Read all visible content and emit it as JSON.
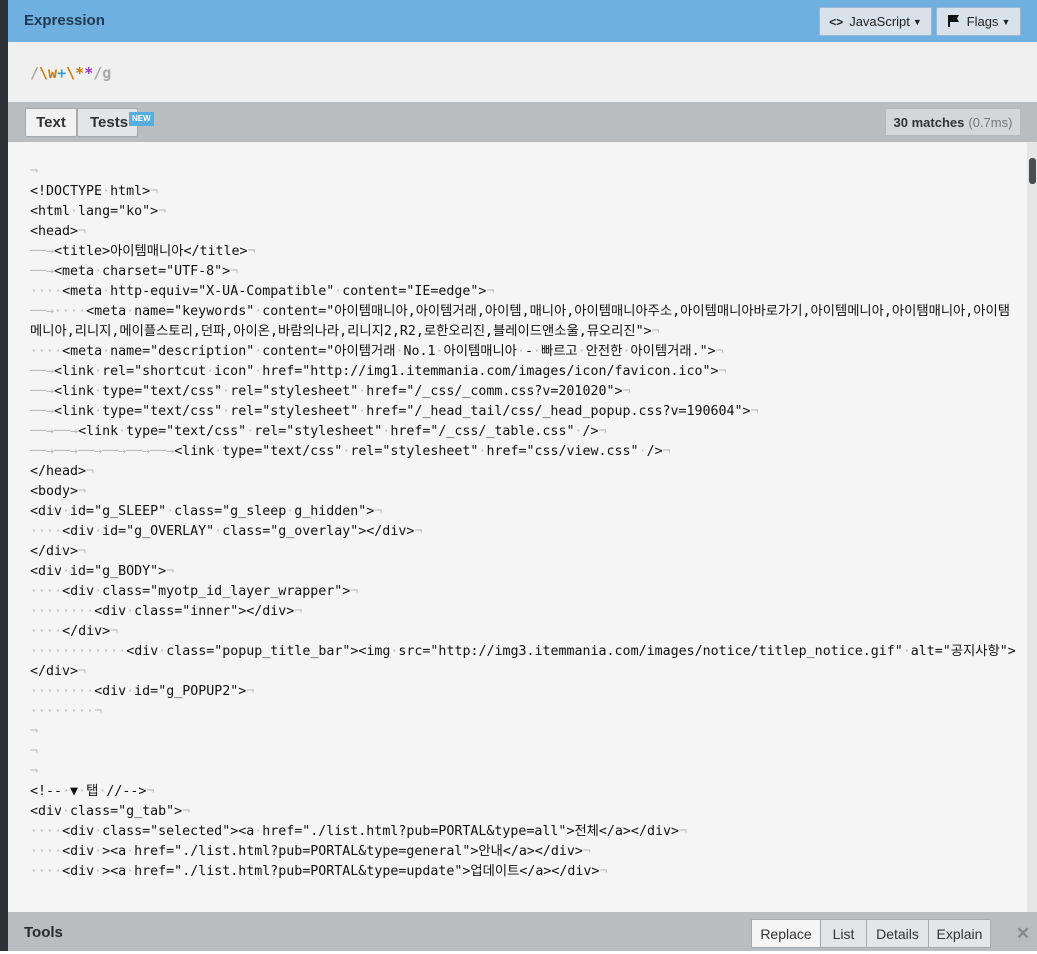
{
  "header": {
    "title": "Expression",
    "flavor_label": "JavaScript",
    "flags_label": "Flags",
    "flavor_icon": "code-icon",
    "flags_icon": "flag-icon"
  },
  "expression": {
    "delimiter_open": "/",
    "token1": "\\w",
    "token2": "+",
    "token3": "\\*",
    "token4": "*",
    "delimiter_close": "/",
    "flags": "g"
  },
  "tabs": {
    "text_label": "Text",
    "tests_label": "Tests",
    "new_badge": "NEW"
  },
  "status": {
    "matches": "30 matches",
    "time": "(0.7ms)"
  },
  "editor": {
    "lines": [
      "¬",
      "<!DOCTYPE·html>¬",
      "<html·lang=\"ko\">¬",
      "<head>¬",
      "──→<title>아이템매니아</title>¬",
      "──→<meta·charset=\"UTF-8\">¬",
      "····<meta·http-equiv=\"X-UA-Compatible\"·content=\"IE=edge\">¬",
      "──→····<meta·name=\"keywords\"·content=\"아이템매니아,아이템거래,아이템,매니아,아이템매니아주소,아이템매니아바로가기,아이템메니아,아이탬매니아,아이탬메니아,리니지,메이플스토리,던파,아이온,바람의나라,리니지2,R2,로한오리진,블레이드앤소울,뮤오리진\">¬",
      "····<meta·name=\"description\"·content=\"아이템거래·No.1·아이템매니아·-·빠르고·안전한·아이템거래.\">¬",
      "──→<link·rel=\"shortcut·icon\"·href=\"http://img1.itemmania.com/images/icon/favicon.ico\">¬",
      "──→<link·type=\"text/css\"·rel=\"stylesheet\"·href=\"/_css/_comm.css?v=201020\">¬",
      "──→<link·type=\"text/css\"·rel=\"stylesheet\"·href=\"/_head_tail/css/_head_popup.css?v=190604\">¬",
      "──→──→<link·type=\"text/css\"·rel=\"stylesheet\"·href=\"/_css/_table.css\"·/>¬",
      "──→──→──→──→──→──→<link·type=\"text/css\"·rel=\"stylesheet\"·href=\"css/view.css\"·/>¬",
      "</head>¬",
      "<body>¬",
      "<div·id=\"g_SLEEP\"·class=\"g_sleep·g_hidden\">¬",
      "····<div·id=\"g_OVERLAY\"·class=\"g_overlay\"></div>¬",
      "</div>¬",
      "<div·id=\"g_BODY\">¬",
      "····<div·class=\"myotp_id_layer_wrapper\">¬",
      "········<div·class=\"inner\"></div>¬",
      "····</div>¬",
      "············<div·class=\"popup_title_bar\"><img·src=\"http://img3.itemmania.com/images/notice/titlep_notice.gif\"·alt=\"공지사항\"></div>¬",
      "········<div·id=\"g_POPUP2\">¬",
      "········¬",
      "¬",
      "¬",
      "¬",
      "<!--·▼·탭·//-->¬",
      "<div·class=\"g_tab\">¬",
      "····<div·class=\"selected\"><a·href=\"./list.html?pub=PORTAL&type=all\">전체</a></div>¬",
      "····<div·><a·href=\"./list.html?pub=PORTAL&type=general\">안내</a></div>¬",
      "····<div·><a·href=\"./list.html?pub=PORTAL&type=update\">업데이트</a></div>¬"
    ]
  },
  "tools": {
    "title": "Tools",
    "replace_label": "Replace",
    "list_label": "List",
    "details_label": "Details",
    "explain_label": "Explain",
    "close_glyph": "✕"
  },
  "colors": {
    "accent": "#70b0e0",
    "token_orange": "#d17a00",
    "token_purple": "#9b35c7",
    "token_teal": "#3aa0c8",
    "token_gray": "#a8a8a8"
  }
}
